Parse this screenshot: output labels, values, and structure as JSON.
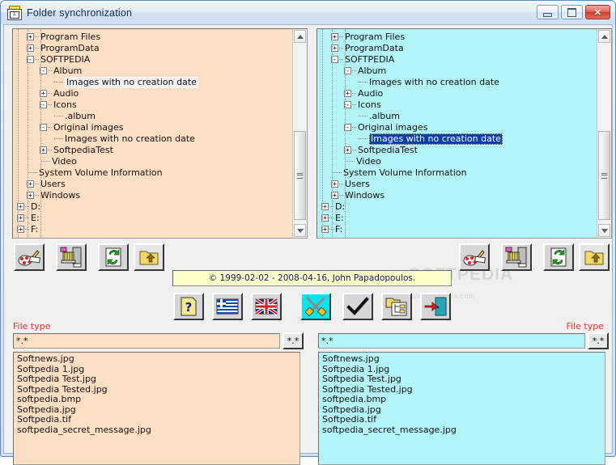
{
  "window": {
    "title": "Folder synchronization",
    "icon": "folder-sync-icon",
    "caption_buttons": {
      "minimize": "minimize-button",
      "maximize": "maximize-button",
      "close": "✕"
    }
  },
  "colors": {
    "left_panel_bg": "#fddfc3",
    "right_panel_bg": "#b3f4f9",
    "label_red": "#e4322b",
    "copyright_bg": "#ffffc9",
    "copyright_text": "#141466",
    "selection_blue": "#0b3fa8"
  },
  "watermark": {
    "big": "SOFTPEDIA",
    "small": "www.softpedia.com"
  },
  "left_tree": {
    "name": "source-folder-tree",
    "nodes": [
      {
        "label": "Program Files",
        "depth": 1,
        "toggle": "+",
        "selected": false
      },
      {
        "label": "ProgramData",
        "depth": 1,
        "toggle": "+",
        "selected": false
      },
      {
        "label": "SOFTPEDIA",
        "depth": 1,
        "toggle": "-",
        "selected": false
      },
      {
        "label": "Album",
        "depth": 2,
        "toggle": "-",
        "selected": false
      },
      {
        "label": "Images with no creation date",
        "depth": 3,
        "toggle": "",
        "selected": "soft"
      },
      {
        "label": "Audio",
        "depth": 2,
        "toggle": "+",
        "selected": false
      },
      {
        "label": "Icons",
        "depth": 2,
        "toggle": "-",
        "selected": false
      },
      {
        "label": ".album",
        "depth": 3,
        "toggle": "",
        "selected": false
      },
      {
        "label": "Original images",
        "depth": 2,
        "toggle": "-",
        "selected": false
      },
      {
        "label": "Images with no creation date",
        "depth": 3,
        "toggle": "",
        "selected": false
      },
      {
        "label": "SoftpediaTest",
        "depth": 2,
        "toggle": "+",
        "selected": false
      },
      {
        "label": "Video",
        "depth": 2,
        "toggle": "",
        "selected": false
      },
      {
        "label": "System Volume Information",
        "depth": 1,
        "toggle": "",
        "selected": false
      },
      {
        "label": "Users",
        "depth": 1,
        "toggle": "+",
        "selected": false
      },
      {
        "label": "Windows",
        "depth": 1,
        "toggle": "+",
        "selected": false
      },
      {
        "label": "D:",
        "depth": 0,
        "toggle": "+",
        "selected": false
      },
      {
        "label": "E:",
        "depth": 0,
        "toggle": "+",
        "selected": false
      },
      {
        "label": "F:",
        "depth": 0,
        "toggle": "+",
        "selected": false
      }
    ]
  },
  "right_tree": {
    "name": "destination-folder-tree",
    "nodes": [
      {
        "label": "Program Files",
        "depth": 1,
        "toggle": "+",
        "selected": false
      },
      {
        "label": "ProgramData",
        "depth": 1,
        "toggle": "+",
        "selected": false
      },
      {
        "label": "SOFTPEDIA",
        "depth": 1,
        "toggle": "-",
        "selected": false
      },
      {
        "label": "Album",
        "depth": 2,
        "toggle": "-",
        "selected": false
      },
      {
        "label": "Images with no creation date",
        "depth": 3,
        "toggle": "",
        "selected": false
      },
      {
        "label": "Audio",
        "depth": 2,
        "toggle": "+",
        "selected": false
      },
      {
        "label": "Icons",
        "depth": 2,
        "toggle": "-",
        "selected": false
      },
      {
        "label": ".album",
        "depth": 3,
        "toggle": "",
        "selected": false
      },
      {
        "label": "Original images",
        "depth": 2,
        "toggle": "-",
        "selected": false
      },
      {
        "label": "Images with no creation date",
        "depth": 3,
        "toggle": "",
        "selected": "blue"
      },
      {
        "label": "SoftpediaTest",
        "depth": 2,
        "toggle": "+",
        "selected": false
      },
      {
        "label": "Video",
        "depth": 2,
        "toggle": "",
        "selected": false
      },
      {
        "label": "System Volume Information",
        "depth": 1,
        "toggle": "",
        "selected": false
      },
      {
        "label": "Users",
        "depth": 1,
        "toggle": "+",
        "selected": false
      },
      {
        "label": "Windows",
        "depth": 1,
        "toggle": "+",
        "selected": false
      },
      {
        "label": "D:",
        "depth": 0,
        "toggle": "+",
        "selected": false
      },
      {
        "label": "E:",
        "depth": 0,
        "toggle": "+",
        "selected": false
      },
      {
        "label": "F:",
        "depth": 0,
        "toggle": "+",
        "selected": false
      }
    ]
  },
  "left_toolbar": [
    {
      "icon": "paint-palette-icon",
      "name": "customize-colors-button"
    },
    {
      "icon": "shredder-icon",
      "name": "delete-files-button"
    },
    {
      "icon": "refresh-document-icon",
      "name": "refresh-button"
    },
    {
      "icon": "folder-up-icon",
      "name": "parent-folder-button"
    }
  ],
  "right_toolbar": [
    {
      "icon": "paint-palette-icon",
      "name": "customize-colors-button"
    },
    {
      "icon": "shredder-icon",
      "name": "delete-files-button"
    },
    {
      "icon": "refresh-document-icon",
      "name": "refresh-button"
    },
    {
      "icon": "folder-up-icon",
      "name": "parent-folder-button"
    }
  ],
  "center_toolbar": [
    {
      "icon": "help-question-icon",
      "name": "help-button"
    },
    {
      "icon": "flag-greece-icon",
      "name": "language-greek-button"
    },
    {
      "icon": "flag-uk-icon",
      "name": "language-english-button"
    },
    {
      "icon": "crossed-swords-icon",
      "name": "compare-button"
    },
    {
      "icon": "checkmark-icon",
      "name": "synchronize-button"
    },
    {
      "icon": "folder-tree-icon",
      "name": "folder-tree-button"
    },
    {
      "icon": "exit-door-icon",
      "name": "exit-button"
    }
  ],
  "copyright": "© 1999-02-02 - 2008-04-16, John Papadopoulos.",
  "left_filter": {
    "label": "File type",
    "value": "*.*",
    "placeholder": "*.*",
    "button_label": "*.*"
  },
  "right_filter": {
    "label": "File type",
    "value": "*.*",
    "placeholder": "*.*",
    "button_label": "*.*"
  },
  "left_files": [
    "Softnews.jpg",
    "Softpedia 1.jpg",
    "Softpedia Test.jpg",
    "Softpedia Tested.jpg",
    "softpedia.bmp",
    "Softpedia.jpg",
    "Softpedia.tif",
    "softpedia_secret_message.jpg"
  ],
  "right_files": [
    "Softnews.jpg",
    "Softpedia 1.jpg",
    "Softpedia Test.jpg",
    "Softpedia Tested.jpg",
    "softpedia.bmp",
    "Softpedia.jpg",
    "Softpedia.tif",
    "softpedia_secret_message.jpg"
  ]
}
